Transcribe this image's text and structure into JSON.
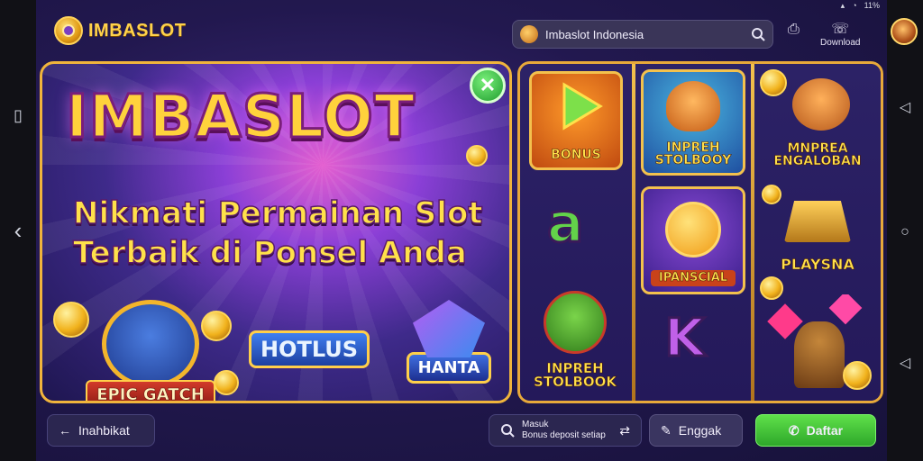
{
  "status_bar": {
    "battery_text": "11%"
  },
  "header": {
    "brand": "IMBASLOT",
    "search": {
      "value": "Imbaslot Indonesia",
      "placeholder": ""
    },
    "icon_labels": {
      "download": "",
      "support": "Download"
    }
  },
  "banner": {
    "title": "IMBASLOT",
    "subtitle_line1": "Nikmati Permainan Slot",
    "subtitle_line2": "Terbaik di Ponsel Anda",
    "badges": [
      {
        "label": "EPIC GATCH"
      },
      {
        "label": "HOTLUS"
      },
      {
        "label": "HANTA"
      }
    ]
  },
  "games": {
    "col1": [
      {
        "label": "BONUS"
      },
      {
        "letter": "a"
      },
      {
        "label": "INPREH\nSTOLBOOK"
      }
    ],
    "col2": [
      {
        "label": "INPREH\nSTOLBOOY"
      },
      {
        "label": "IPANSCIAL"
      },
      {
        "letter": "K"
      }
    ],
    "col3": [
      {
        "label": "MNPREA\nENGALOBAN"
      },
      {
        "label": "PLAYSNA"
      },
      {
        "label": ""
      }
    ]
  },
  "bottom_bar": {
    "back_label": "Inahbikat",
    "info_line1": "Masuk",
    "info_line2": "Bonus deposit setiap",
    "share_label": "Enggak",
    "play_label": "Daftar"
  },
  "colors": {
    "accent_gold": "#f3c14d",
    "play_green": "#3cc02f",
    "bg_purple": "#22184f"
  }
}
